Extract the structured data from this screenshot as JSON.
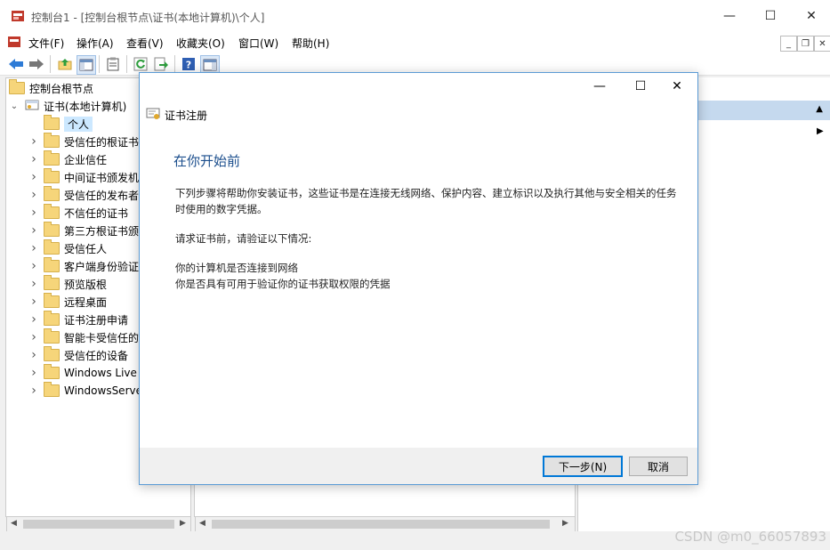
{
  "window": {
    "title": "控制台1 - [控制台根节点\\证书(本地计算机)\\个人]",
    "minimize_glyph": "—",
    "maximize_glyph": "☐",
    "close_glyph": "✕"
  },
  "menu": {
    "items": [
      "文件(F)",
      "操作(A)",
      "查看(V)",
      "收藏夹(O)",
      "窗口(W)",
      "帮助(H)"
    ],
    "mdi_min": "_",
    "mdi_restore": "❐",
    "mdi_close": "✕"
  },
  "toolbar": {
    "icons": [
      "back-icon",
      "forward-icon",
      "up-folder-icon",
      "show-hide-tree-icon",
      "properties-icon",
      "refresh-icon",
      "export-list-icon",
      "help-icon",
      "show-hide-action-pane-icon"
    ]
  },
  "tree": {
    "root": "控制台根节点",
    "store": "证书(本地计算机)",
    "items": [
      {
        "label": "个人",
        "selected": true,
        "expandable": false
      },
      {
        "label": "受信任的根证书颁",
        "expandable": true
      },
      {
        "label": "企业信任",
        "expandable": true
      },
      {
        "label": "中间证书颁发机构",
        "expandable": true
      },
      {
        "label": "受信任的发布者",
        "expandable": true
      },
      {
        "label": "不信任的证书",
        "expandable": true
      },
      {
        "label": "第三方根证书颁发",
        "expandable": true
      },
      {
        "label": "受信任人",
        "expandable": true
      },
      {
        "label": "客户端身份验证颁",
        "expandable": true
      },
      {
        "label": "预览版根",
        "expandable": true
      },
      {
        "label": "远程桌面",
        "expandable": true
      },
      {
        "label": "证书注册申请",
        "expandable": true
      },
      {
        "label": "智能卡受信任的根",
        "expandable": true
      },
      {
        "label": "受信任的设备",
        "expandable": true
      },
      {
        "label": "Windows Live I",
        "expandable": true
      },
      {
        "label": "WindowsServe",
        "expandable": true
      }
    ]
  },
  "dialog": {
    "title": "证书注册",
    "heading": "在你开始前",
    "paragraph1": "下列步骤将帮助你安装证书，这些证书是在连接无线网络、保护内容、建立标识以及执行其他与安全相关的任务时使用的数字凭据。",
    "paragraph2": "请求证书前，请验证以下情况:",
    "line1": "你的计算机是否连接到网络",
    "line2": "你是否具有可用于验证你的证书获取权限的凭据",
    "next_label": "下一步(N)",
    "cancel_label": "取消"
  },
  "watermark": "CSDN @m0_66057893",
  "colors": {
    "accent": "#0078d7",
    "heading": "#1a4d8c",
    "action_header": "#c5d9ee",
    "folder": "#f6d57a"
  }
}
